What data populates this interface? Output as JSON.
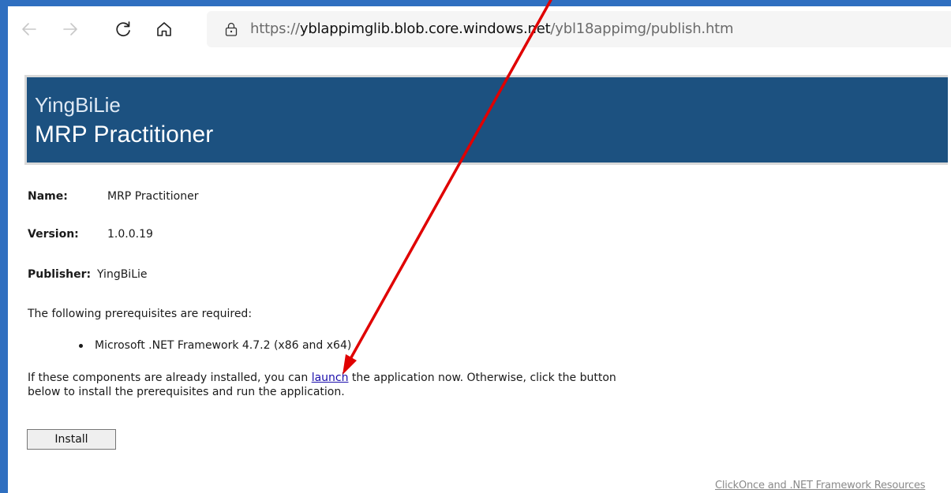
{
  "browser": {
    "url_scheme": "https://",
    "url_host": "yblappimglib.blob.core.windows.net",
    "url_path": "/ybl18appimg/publish.htm",
    "icons": {
      "back": "back-arrow-icon",
      "forward": "forward-arrow-icon",
      "reload": "reload-icon",
      "home": "home-icon",
      "lock": "lock-icon"
    }
  },
  "banner": {
    "company": "YingBiLie",
    "product": "MRP Practitioner"
  },
  "fields": {
    "name_label": "Name:",
    "name_value": "MRP Practitioner",
    "version_label": "Version:",
    "version_value": "1.0.0.19",
    "publisher_label": "Publisher:",
    "publisher_value": "YingBiLie"
  },
  "prerequisites": {
    "intro": "The following prerequisites are required:",
    "items": [
      "Microsoft .NET Framework 4.7.2 (x86 and x64)"
    ]
  },
  "instructions": {
    "before_link": "If these components are already installed, you can ",
    "link_text": "launch",
    "after_link": " the application now. Otherwise, click the button below to install the prerequisites and run the application."
  },
  "install_button_label": "Install",
  "resources_link": "ClickOnce and .NET Framework Resources",
  "colors": {
    "banner": "#1c5180",
    "frame_accent": "#2f6fc0",
    "annotation_arrow": "#e00000"
  }
}
